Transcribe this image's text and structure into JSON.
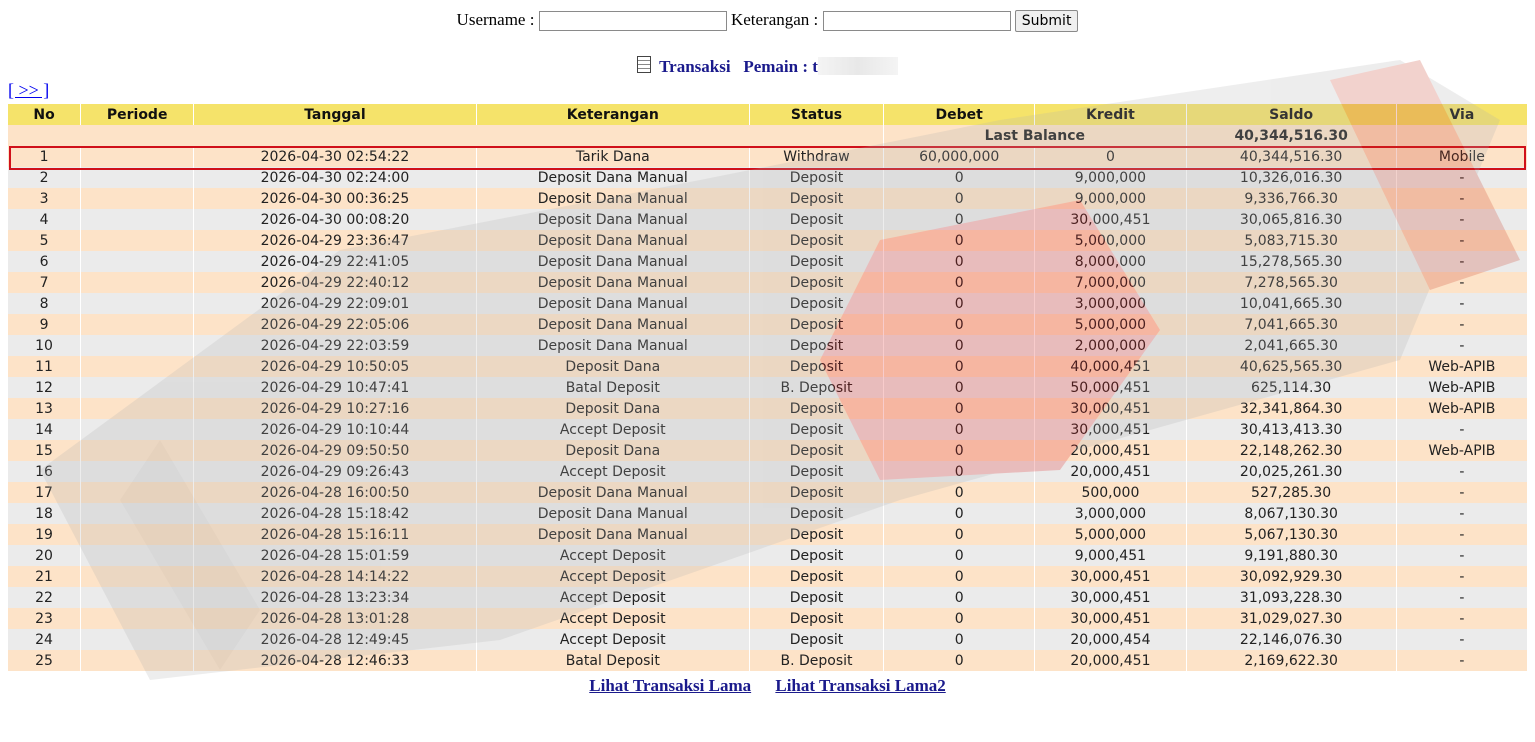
{
  "filter": {
    "username_label": "Username :",
    "username_value": "",
    "keterangan_label": "Keterangan :",
    "keterangan_value": "",
    "submit_label": "Submit"
  },
  "header": {
    "transaksi_label": "Transaksi",
    "pemain_label": "Pemain : t"
  },
  "nav": {
    "next_link": "[ >> ]"
  },
  "table": {
    "columns": [
      "No",
      "Periode",
      "Tanggal",
      "Keterangan",
      "Status",
      "Debet",
      "Kredit",
      "Saldo",
      "Via"
    ],
    "last_balance_label": "Last Balance",
    "last_balance_value": "40,344,516.30",
    "rows": [
      {
        "no": "1",
        "periode": "",
        "tanggal": "2026-04-30 02:54:22",
        "keterangan": "Tarik Dana",
        "status": "Withdraw",
        "debet": "60,000,000",
        "kredit": "0",
        "saldo": "40,344,516.30",
        "via": "Mobile"
      },
      {
        "no": "2",
        "periode": "",
        "tanggal": "2026-04-30 02:24:00",
        "keterangan": "Deposit Dana Manual",
        "status": "Deposit",
        "debet": "0",
        "kredit": "9,000,000",
        "saldo": "10,326,016.30",
        "via": "-"
      },
      {
        "no": "3",
        "periode": "",
        "tanggal": "2026-04-30 00:36:25",
        "keterangan": "Deposit Dana Manual",
        "status": "Deposit",
        "debet": "0",
        "kredit": "9,000,000",
        "saldo": "9,336,766.30",
        "via": "-"
      },
      {
        "no": "4",
        "periode": "",
        "tanggal": "2026-04-30 00:08:20",
        "keterangan": "Deposit Dana Manual",
        "status": "Deposit",
        "debet": "0",
        "kredit": "30,000,451",
        "saldo": "30,065,816.30",
        "via": "-"
      },
      {
        "no": "5",
        "periode": "",
        "tanggal": "2026-04-29 23:36:47",
        "keterangan": "Deposit Dana Manual",
        "status": "Deposit",
        "debet": "0",
        "kredit": "5,000,000",
        "saldo": "5,083,715.30",
        "via": "-"
      },
      {
        "no": "6",
        "periode": "",
        "tanggal": "2026-04-29 22:41:05",
        "keterangan": "Deposit Dana Manual",
        "status": "Deposit",
        "debet": "0",
        "kredit": "8,000,000",
        "saldo": "15,278,565.30",
        "via": "-"
      },
      {
        "no": "7",
        "periode": "",
        "tanggal": "2026-04-29 22:40:12",
        "keterangan": "Deposit Dana Manual",
        "status": "Deposit",
        "debet": "0",
        "kredit": "7,000,000",
        "saldo": "7,278,565.30",
        "via": "-"
      },
      {
        "no": "8",
        "periode": "",
        "tanggal": "2026-04-29 22:09:01",
        "keterangan": "Deposit Dana Manual",
        "status": "Deposit",
        "debet": "0",
        "kredit": "3,000,000",
        "saldo": "10,041,665.30",
        "via": "-"
      },
      {
        "no": "9",
        "periode": "",
        "tanggal": "2026-04-29 22:05:06",
        "keterangan": "Deposit Dana Manual",
        "status": "Deposit",
        "debet": "0",
        "kredit": "5,000,000",
        "saldo": "7,041,665.30",
        "via": "-"
      },
      {
        "no": "10",
        "periode": "",
        "tanggal": "2026-04-29 22:03:59",
        "keterangan": "Deposit Dana Manual",
        "status": "Deposit",
        "debet": "0",
        "kredit": "2,000,000",
        "saldo": "2,041,665.30",
        "via": "-"
      },
      {
        "no": "11",
        "periode": "",
        "tanggal": "2026-04-29 10:50:05",
        "keterangan": "Deposit Dana",
        "status": "Deposit",
        "debet": "0",
        "kredit": "40,000,451",
        "saldo": "40,625,565.30",
        "via": "Web-APIB"
      },
      {
        "no": "12",
        "periode": "",
        "tanggal": "2026-04-29 10:47:41",
        "keterangan": "Batal Deposit",
        "status": "B. Deposit",
        "debet": "0",
        "kredit": "50,000,451",
        "saldo": "625,114.30",
        "via": "Web-APIB"
      },
      {
        "no": "13",
        "periode": "",
        "tanggal": "2026-04-29 10:27:16",
        "keterangan": "Deposit Dana",
        "status": "Deposit",
        "debet": "0",
        "kredit": "30,000,451",
        "saldo": "32,341,864.30",
        "via": "Web-APIB"
      },
      {
        "no": "14",
        "periode": "",
        "tanggal": "2026-04-29 10:10:44",
        "keterangan": "Accept Deposit",
        "status": "Deposit",
        "debet": "0",
        "kredit": "30,000,451",
        "saldo": "30,413,413.30",
        "via": "-"
      },
      {
        "no": "15",
        "periode": "",
        "tanggal": "2026-04-29 09:50:50",
        "keterangan": "Deposit Dana",
        "status": "Deposit",
        "debet": "0",
        "kredit": "20,000,451",
        "saldo": "22,148,262.30",
        "via": "Web-APIB"
      },
      {
        "no": "16",
        "periode": "",
        "tanggal": "2026-04-29 09:26:43",
        "keterangan": "Accept Deposit",
        "status": "Deposit",
        "debet": "0",
        "kredit": "20,000,451",
        "saldo": "20,025,261.30",
        "via": "-"
      },
      {
        "no": "17",
        "periode": "",
        "tanggal": "2026-04-28 16:00:50",
        "keterangan": "Deposit Dana Manual",
        "status": "Deposit",
        "debet": "0",
        "kredit": "500,000",
        "saldo": "527,285.30",
        "via": "-"
      },
      {
        "no": "18",
        "periode": "",
        "tanggal": "2026-04-28 15:18:42",
        "keterangan": "Deposit Dana Manual",
        "status": "Deposit",
        "debet": "0",
        "kredit": "3,000,000",
        "saldo": "8,067,130.30",
        "via": "-"
      },
      {
        "no": "19",
        "periode": "",
        "tanggal": "2026-04-28 15:16:11",
        "keterangan": "Deposit Dana Manual",
        "status": "Deposit",
        "debet": "0",
        "kredit": "5,000,000",
        "saldo": "5,067,130.30",
        "via": "-"
      },
      {
        "no": "20",
        "periode": "",
        "tanggal": "2026-04-28 15:01:59",
        "keterangan": "Accept Deposit",
        "status": "Deposit",
        "debet": "0",
        "kredit": "9,000,451",
        "saldo": "9,191,880.30",
        "via": "-"
      },
      {
        "no": "21",
        "periode": "",
        "tanggal": "2026-04-28 14:14:22",
        "keterangan": "Accept Deposit",
        "status": "Deposit",
        "debet": "0",
        "kredit": "30,000,451",
        "saldo": "30,092,929.30",
        "via": "-"
      },
      {
        "no": "22",
        "periode": "",
        "tanggal": "2026-04-28 13:23:34",
        "keterangan": "Accept Deposit",
        "status": "Deposit",
        "debet": "0",
        "kredit": "30,000,451",
        "saldo": "31,093,228.30",
        "via": "-"
      },
      {
        "no": "23",
        "periode": "",
        "tanggal": "2026-04-28 13:01:28",
        "keterangan": "Accept Deposit",
        "status": "Deposit",
        "debet": "0",
        "kredit": "30,000,451",
        "saldo": "31,029,027.30",
        "via": "-"
      },
      {
        "no": "24",
        "periode": "",
        "tanggal": "2026-04-28 12:49:45",
        "keterangan": "Accept Deposit",
        "status": "Deposit",
        "debet": "0",
        "kredit": "20,000,454",
        "saldo": "22,146,076.30",
        "via": "-"
      },
      {
        "no": "25",
        "periode": "",
        "tanggal": "2026-04-28 12:46:33",
        "keterangan": "Batal Deposit",
        "status": "B. Deposit",
        "debet": "0",
        "kredit": "20,000,451",
        "saldo": "2,169,622.30",
        "via": "-"
      }
    ]
  },
  "footer": {
    "link1": "Lihat Transaksi Lama",
    "link2": "Lihat Transaksi Lama2"
  },
  "colors": {
    "header_bg": "#f5e36a",
    "row_odd_bg": "#fde3c8",
    "row_even_bg": "#ebebeb",
    "status_text": "#d11a1a",
    "amount_text": "#2a2ad0",
    "highlight_box": "#d0101a"
  },
  "icons": {
    "transaksi": "document-icon"
  }
}
